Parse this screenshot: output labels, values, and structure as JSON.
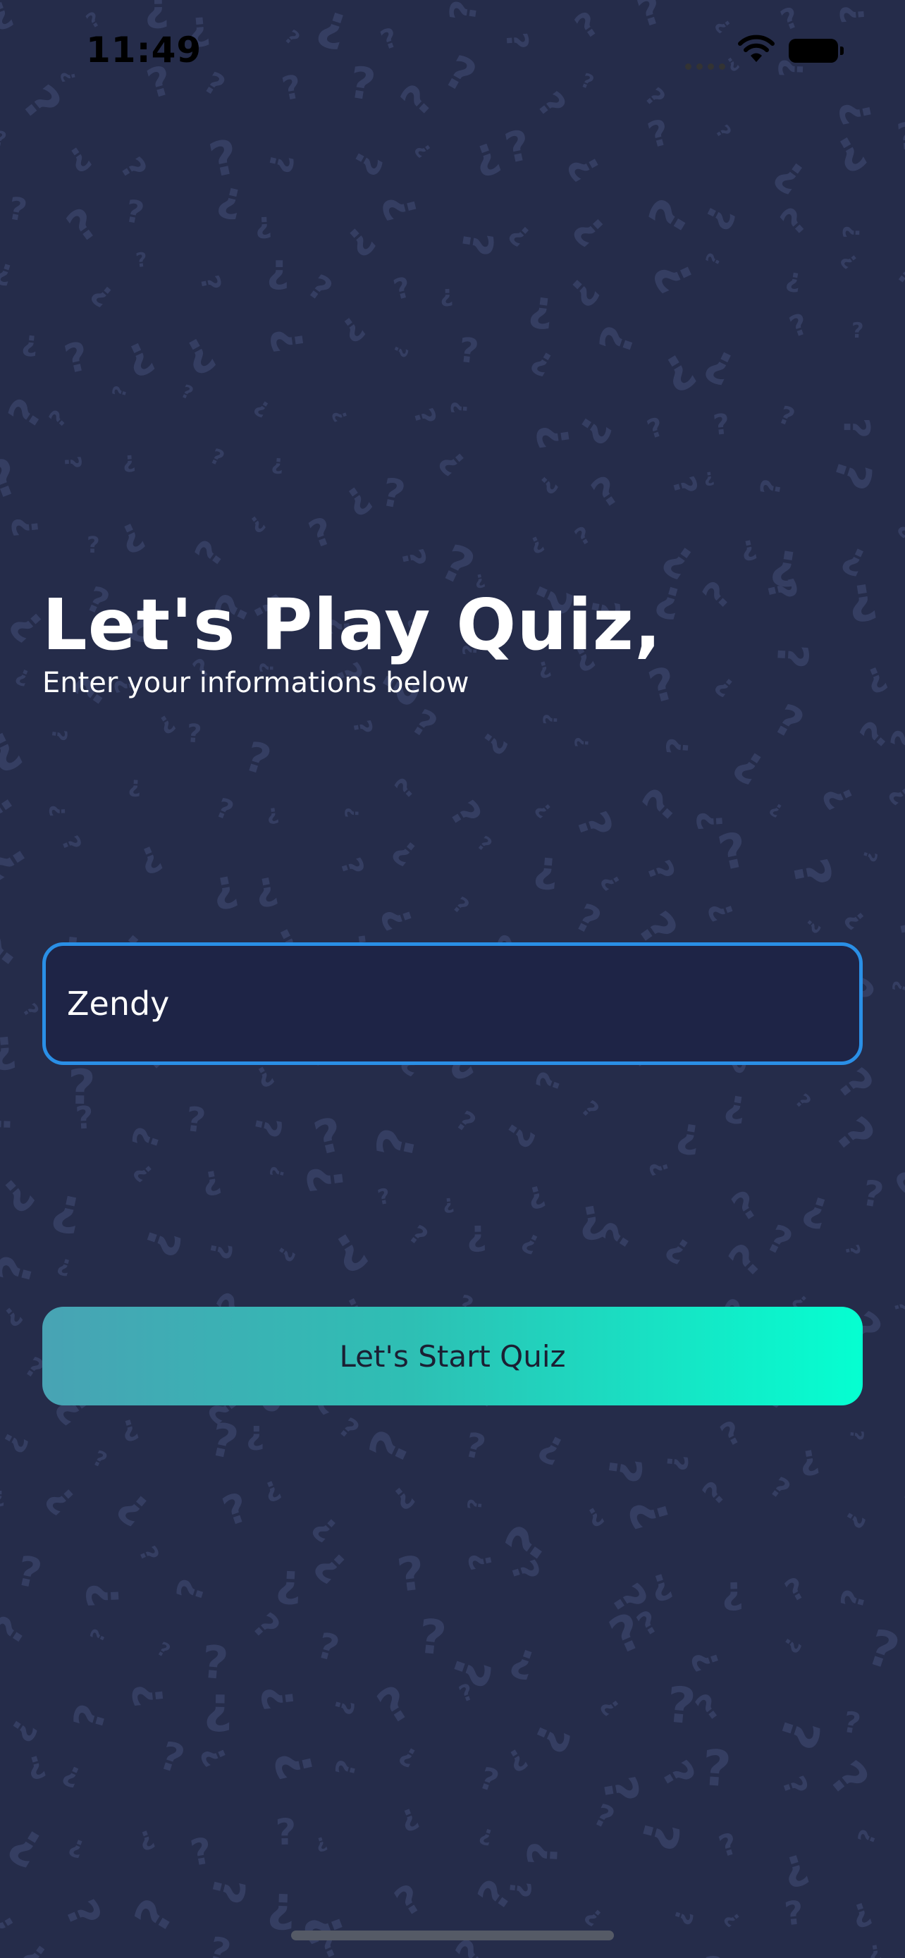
{
  "status_bar": {
    "time": "11:49",
    "icons": [
      "signal-dots-icon",
      "wifi-icon",
      "battery-icon"
    ]
  },
  "background": {
    "color": "#252c4a",
    "pattern_glyph_color": "#353e62",
    "pattern_glyphs": [
      "?",
      "¿"
    ]
  },
  "header": {
    "title": "Let's Play Quiz,",
    "subtitle": "Enter your informations below"
  },
  "name_input": {
    "value": "Zendy",
    "border_color": "#2a8fe6",
    "fill_color": "#1e2446"
  },
  "start_button": {
    "label": "Let's Start Quiz",
    "gradient": [
      "#48a3b4",
      "#05ffd1"
    ]
  }
}
